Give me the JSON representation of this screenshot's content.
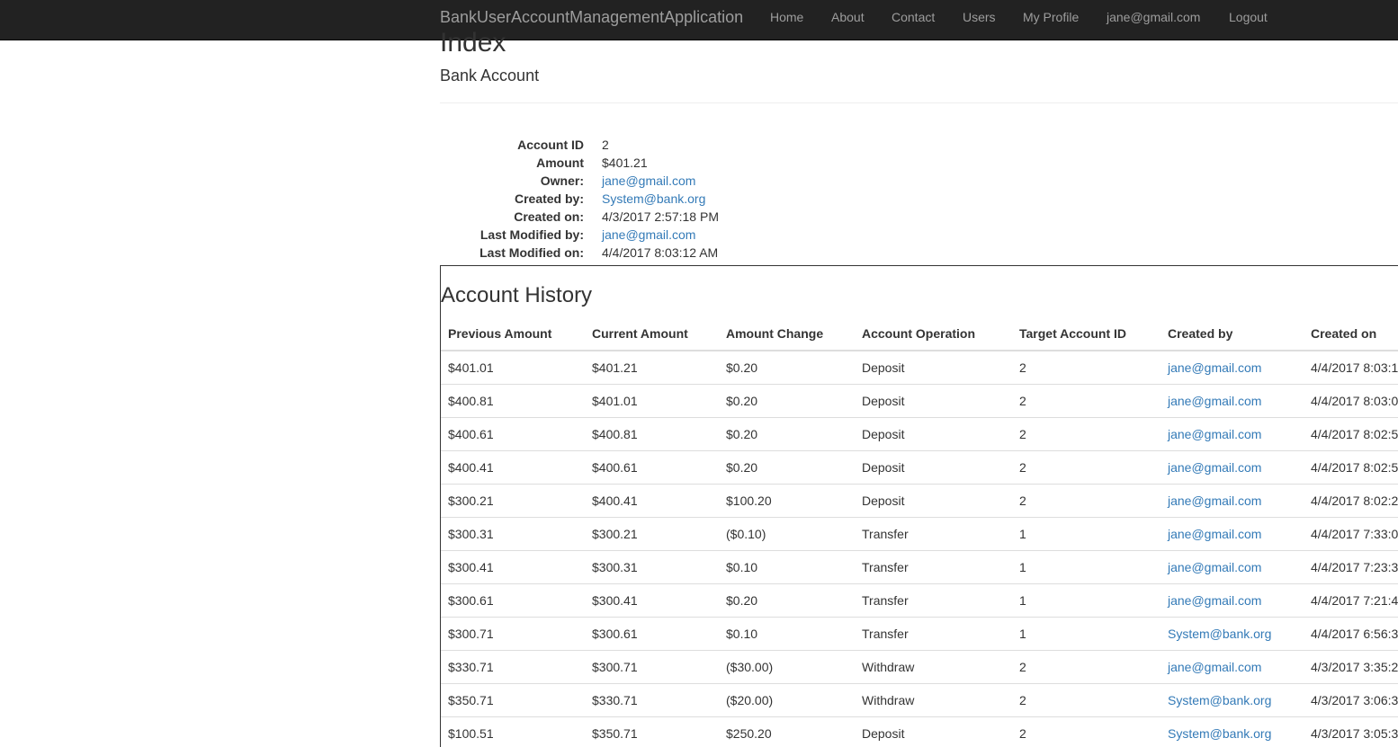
{
  "navbar": {
    "brand": "BankUserAccountManagementApplication",
    "links": [
      "Home",
      "About",
      "Contact",
      "Users",
      "My Profile",
      "jane@gmail.com",
      "Logout"
    ]
  },
  "page": {
    "title": "Index",
    "subtitle": "Bank Account"
  },
  "details": {
    "account_id_label": "Account ID",
    "account_id": "2",
    "amount_label": "Amount",
    "amount": "$401.21",
    "owner_label": "Owner:",
    "owner": "jane@gmail.com",
    "created_by_label": "Created by:",
    "created_by": "System@bank.org",
    "created_on_label": "Created on:",
    "created_on": "4/3/2017 2:57:18 PM",
    "last_modified_by_label": "Last Modified by:",
    "last_modified_by": "jane@gmail.com",
    "last_modified_on_label": "Last Modified on:",
    "last_modified_on": "4/4/2017 8:03:12 AM"
  },
  "history": {
    "title": "Account History",
    "columns": [
      "Previous Amount",
      "Current Amount",
      "Amount Change",
      "Account Operation",
      "Target Account ID",
      "Created by",
      "Created on"
    ],
    "rows": [
      [
        "$401.01",
        "$401.21",
        "$0.20",
        "Deposit",
        "2",
        "jane@gmail.com",
        "4/4/2017 8:03:1"
      ],
      [
        "$400.81",
        "$401.01",
        "$0.20",
        "Deposit",
        "2",
        "jane@gmail.com",
        "4/4/2017 8:03:0"
      ],
      [
        "$400.61",
        "$400.81",
        "$0.20",
        "Deposit",
        "2",
        "jane@gmail.com",
        "4/4/2017 8:02:5"
      ],
      [
        "$400.41",
        "$400.61",
        "$0.20",
        "Deposit",
        "2",
        "jane@gmail.com",
        "4/4/2017 8:02:5"
      ],
      [
        "$300.21",
        "$400.41",
        "$100.20",
        "Deposit",
        "2",
        "jane@gmail.com",
        "4/4/2017 8:02:2"
      ],
      [
        "$300.31",
        "$300.21",
        "($0.10)",
        "Transfer",
        "1",
        "jane@gmail.com",
        "4/4/2017 7:33:0"
      ],
      [
        "$300.41",
        "$300.31",
        "$0.10",
        "Transfer",
        "1",
        "jane@gmail.com",
        "4/4/2017 7:23:3"
      ],
      [
        "$300.61",
        "$300.41",
        "$0.20",
        "Transfer",
        "1",
        "jane@gmail.com",
        "4/4/2017 7:21:4"
      ],
      [
        "$300.71",
        "$300.61",
        "$0.10",
        "Transfer",
        "1",
        "System@bank.org",
        "4/4/2017 6:56:3"
      ],
      [
        "$330.71",
        "$300.71",
        "($30.00)",
        "Withdraw",
        "2",
        "jane@gmail.com",
        "4/3/2017 3:35:2"
      ],
      [
        "$350.71",
        "$330.71",
        "($20.00)",
        "Withdraw",
        "2",
        "System@bank.org",
        "4/3/2017 3:06:3"
      ],
      [
        "$100.51",
        "$350.71",
        "$250.20",
        "Deposit",
        "2",
        "System@bank.org",
        "4/3/2017 3:05:3"
      ]
    ]
  },
  "colors": {
    "navbar_bg": "#222222",
    "nav_text": "#9d9d9d",
    "link": "#337ab7",
    "text": "#333333"
  }
}
